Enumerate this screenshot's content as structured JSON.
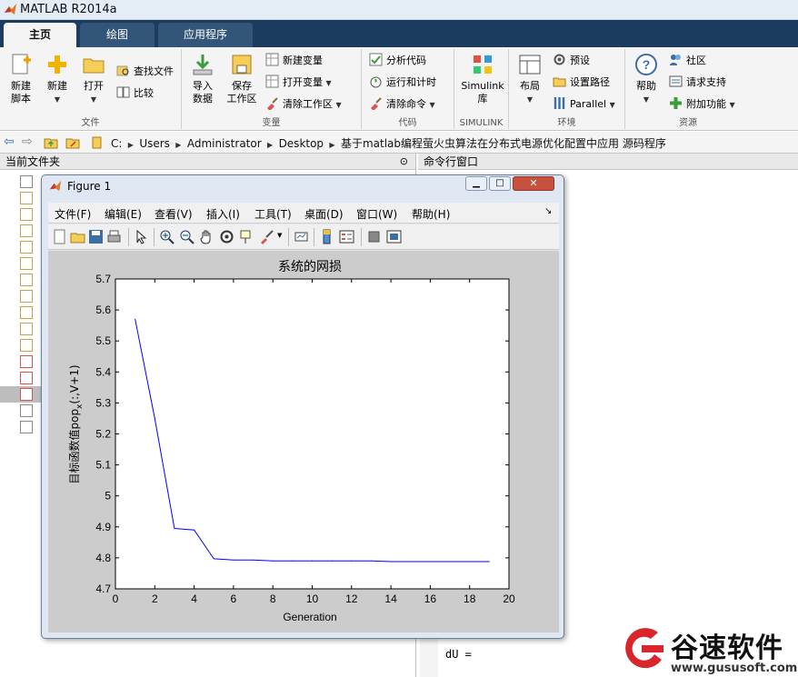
{
  "app": {
    "title": "MATLAB R2014a"
  },
  "tabs": [
    {
      "label": "主页"
    },
    {
      "label": "绘图"
    },
    {
      "label": "应用程序"
    }
  ],
  "ribbon": {
    "file_group": {
      "label": "文件",
      "new_script": "新建\n脚本",
      "new": "新建",
      "open": "打开",
      "find_files": "查找文件",
      "compare": "比较"
    },
    "variable_group": {
      "label": "变量",
      "import": "导入\n数据",
      "save": "保存\n工作区",
      "new_var": "新建变量",
      "open_var": "打开变量",
      "clear_ws": "清除工作区"
    },
    "code_group": {
      "label": "代码",
      "analyze": "分析代码",
      "run_time": "运行和计时",
      "clear_cmd": "清除命令"
    },
    "simulink_group": {
      "label": "SIMULINK",
      "simulink": "Simulink\n库"
    },
    "env_group": {
      "label": "环境",
      "layout": "布局",
      "prefs": "预设",
      "set_path": "设置路径",
      "parallel": "Parallel"
    },
    "resources_group": {
      "label": "资源",
      "help": "帮助",
      "community": "社区",
      "support": "请求支持",
      "addons": "附加功能"
    }
  },
  "address": {
    "crumbs": [
      "C:",
      "Users",
      "Administrator",
      "Desktop",
      "基于matlab编程萤火虫算法在分布式电源优化配置中应用 源码程序"
    ]
  },
  "left_pane": {
    "title": "当前文件夹"
  },
  "right_pane": {
    "title": "命令行窗口",
    "output": "dU ="
  },
  "figure": {
    "title": "Figure 1",
    "menus": [
      "文件(F)",
      "编辑(E)",
      "查看(V)",
      "插入(I)",
      "工具(T)",
      "桌面(D)",
      "窗口(W)",
      "帮助(H)"
    ]
  },
  "chart_data": {
    "type": "line",
    "title": "系统的网损",
    "xlabel": "Generation",
    "ylabel": "目标函数值pop_x(:,V+1)",
    "xlim": [
      0,
      20
    ],
    "ylim": [
      4.7,
      5.7
    ],
    "xticks": [
      0,
      2,
      4,
      6,
      8,
      10,
      12,
      14,
      16,
      18,
      20
    ],
    "yticks": [
      4.7,
      4.8,
      4.9,
      5,
      5.1,
      5.2,
      5.3,
      5.4,
      5.5,
      5.6,
      5.7
    ],
    "x": [
      1,
      2,
      3,
      4,
      5,
      6,
      7,
      8,
      9,
      10,
      11,
      12,
      13,
      14,
      15,
      16,
      17,
      18,
      19
    ],
    "y": [
      5.57,
      5.25,
      4.895,
      4.89,
      4.797,
      4.793,
      4.793,
      4.79,
      4.79,
      4.79,
      4.79,
      4.79,
      4.79,
      4.788,
      4.788,
      4.788,
      4.788,
      4.788,
      4.788
    ],
    "color": "#0000ff"
  },
  "watermark": {
    "brand": "谷速软件",
    "url": "www.gususoft.com",
    "color": "#d9262c"
  }
}
